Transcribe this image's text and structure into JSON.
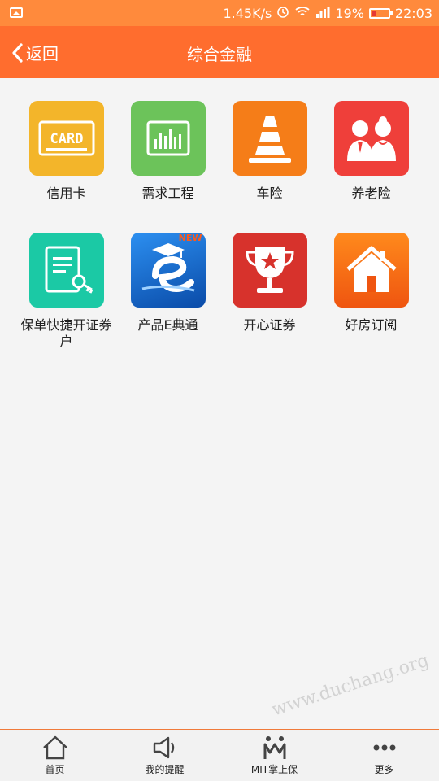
{
  "status_bar": {
    "speed": "1.45K/s",
    "battery": "19%",
    "time": "22:03"
  },
  "nav": {
    "back_label": "返回",
    "title": "综合金融"
  },
  "apps": [
    {
      "label": "信用卡",
      "icon": "card-icon",
      "icon_text": "CARD",
      "color": "#f3b52a"
    },
    {
      "label": "需求工程",
      "icon": "chart-board-icon",
      "color": "#6cc35a"
    },
    {
      "label": "车险",
      "icon": "traffic-cone-icon",
      "color": "#f57d18"
    },
    {
      "label": "养老险",
      "icon": "elderly-couple-icon",
      "color": "#ef3f3a"
    },
    {
      "label": "保单快捷开证券户",
      "icon": "document-key-icon",
      "color": "#1bc9a5"
    },
    {
      "label": "产品E典通",
      "icon": "e-graduation-icon",
      "icon_text": "NEW",
      "color": "#1a6fd0"
    },
    {
      "label": "开心证券",
      "icon": "trophy-icon",
      "color": "#d7322c"
    },
    {
      "label": "好房订阅",
      "icon": "house-icon",
      "color": "#f56a16"
    }
  ],
  "tabs": [
    {
      "label": "首页",
      "icon": "home-icon"
    },
    {
      "label": "我的提醒",
      "icon": "speaker-icon"
    },
    {
      "label": "MIT掌上保",
      "icon": "mit-icon"
    },
    {
      "label": "更多",
      "icon": "more-dots-icon"
    }
  ],
  "watermark": "www.duchang.org"
}
